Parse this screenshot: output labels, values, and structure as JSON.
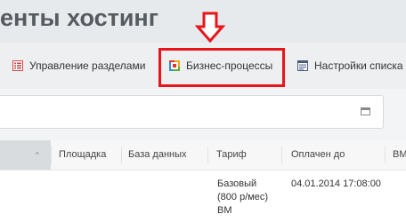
{
  "header": {
    "title": "енты хостинг"
  },
  "toolbar": {
    "items": [
      {
        "label": "Управление разделами",
        "icon": "sections-list-icon"
      },
      {
        "label": "Бизнес-процессы",
        "icon": "business-process-icon"
      },
      {
        "label": "Настройки списка",
        "icon": "list-settings-icon"
      }
    ]
  },
  "annotation": {
    "highlight_color": "#e8151b"
  },
  "filter": {
    "icon": "window-icon"
  },
  "table": {
    "sort_indicator": "^",
    "columns": [
      "Площадка",
      "База данных",
      "Тариф",
      "Оплачен до",
      "ВМ"
    ],
    "rows": [
      {
        "tariff_lines": [
          "Базовый",
          "(800 р/мес)",
          "ВМ"
        ],
        "paid_until": "04.01.2014 17:08:00"
      }
    ]
  }
}
